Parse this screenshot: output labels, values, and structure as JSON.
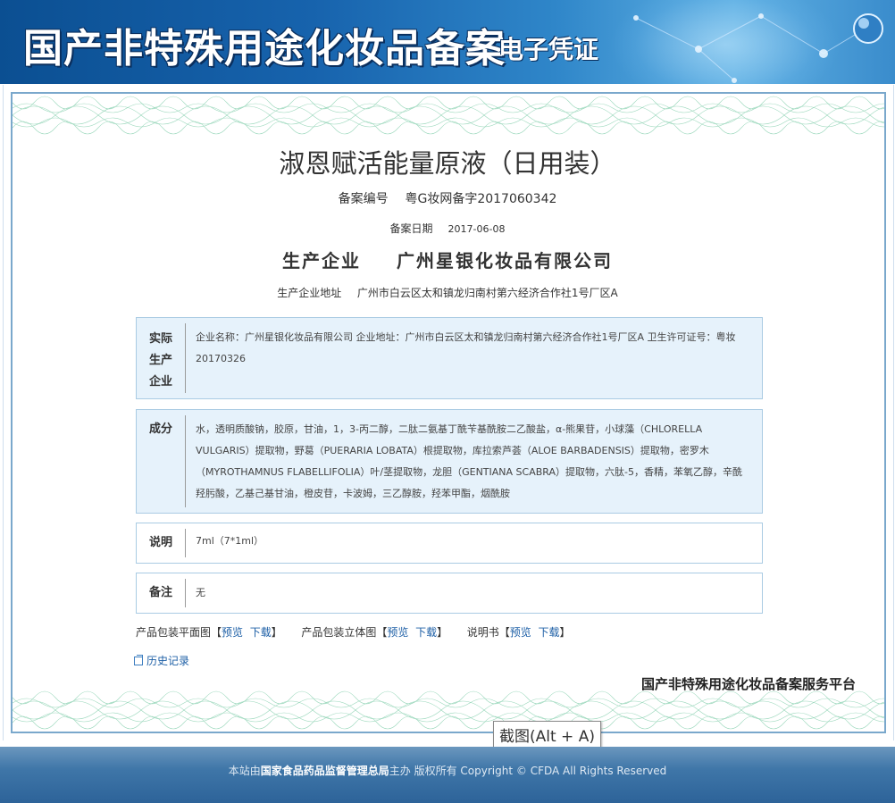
{
  "header": {
    "title": "国产非特殊用途化妆品备案",
    "subtitle": "电子凭证"
  },
  "product": {
    "name": "淑恩赋活能量原液（日用装）",
    "record_no_label": "备案编号",
    "record_no": "粤G妆网备字2017060342",
    "record_date_label": "备案日期",
    "record_date": "2017-06-08",
    "manufacturer_label": "生产企业",
    "manufacturer": "广州星银化妆品有限公司",
    "manufacturer_address_label": "生产企业地址",
    "manufacturer_address": "广州市白云区太和镇龙归南村第六经济合作社1号厂区A"
  },
  "panels": {
    "actual_producer": {
      "label": "实际\n生产\n企业",
      "value": "企业名称：广州星银化妆品有限公司   企业地址：广州市白云区太和镇龙归南村第六经济合作社1号厂区A   卫生许可证号：粤妆20170326"
    },
    "ingredients": {
      "label": "成分",
      "value": "水，透明质酸钠，胶原，甘油，1，3-丙二醇，二肽二氨基丁酰苄基酰胺二乙酸盐，α-熊果苷，小球藻（CHLORELLA VULGARIS）提取物，野葛（PUERARIA LOBATA）根提取物，库拉索芦荟（ALOE BARBADENSIS）提取物，密罗木（MYROTHAMNUS FLABELLIFOLIA）叶/茎提取物，龙胆（GENTIANA SCABRA）提取物，六肽-5，香精，苯氧乙醇，辛酰羟肟酸，乙基己基甘油，橙皮苷，卡波姆，三乙醇胺，羟苯甲酯，烟酰胺"
    },
    "description": {
      "label": "说明",
      "value": "7ml（7*1ml）"
    },
    "remarks": {
      "label": "备注",
      "value": "无"
    }
  },
  "downloads": {
    "flat_label": "产品包装平面图",
    "stereo_label": "产品包装立体图",
    "manual_label": "说明书",
    "preview": "预览",
    "download": "下载",
    "bracket_open": "【",
    "bracket_close": "】"
  },
  "history_link": "历史记录",
  "platform_name": "国产非特殊用途化妆品备案服务平台",
  "screenshot_tip": "截图(Alt + A)",
  "footer": {
    "prefix": "本站由",
    "org": "国家食品药品监督管理总局",
    "suffix": "主办 版权所有 Copyright © CFDA All Rights Reserved"
  },
  "colors": {
    "banner_blue": "#1763ad",
    "panel_blue_bg": "#e6f2fb",
    "panel_border": "#a9cbe3",
    "link_blue": "#1d5fa6",
    "footer_blue": "#3f76a8"
  }
}
